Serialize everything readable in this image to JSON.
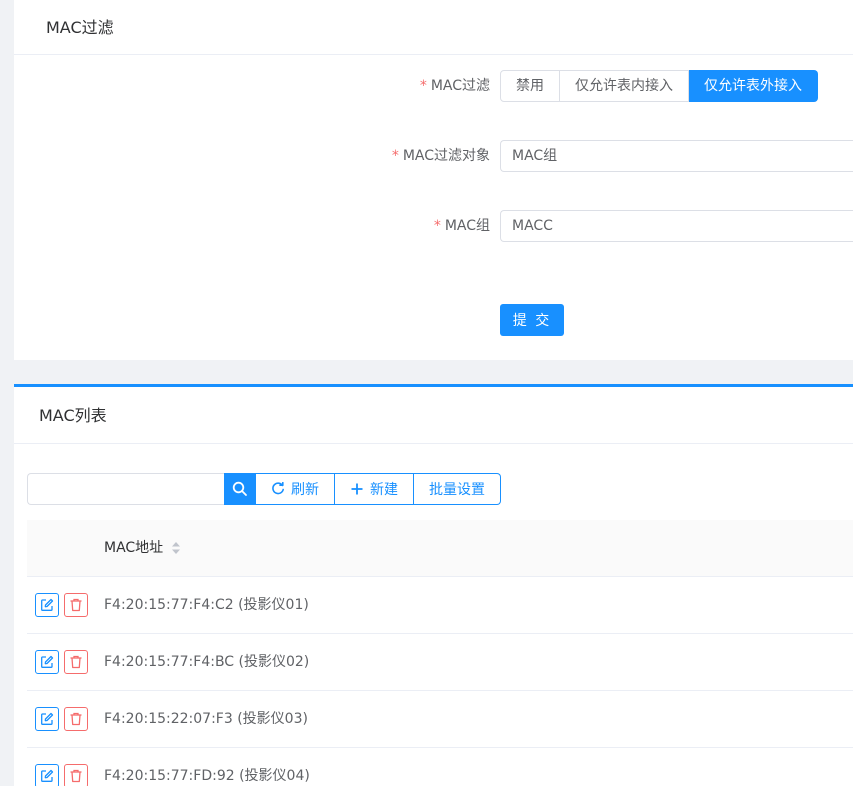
{
  "filter_card": {
    "title": "MAC过滤",
    "fields": {
      "mode": {
        "label": "MAC过滤",
        "required_mark": "*",
        "options": [
          "禁用",
          "仅允许表内接入",
          "仅允许表外接入"
        ],
        "selected_index": 2
      },
      "target": {
        "label": "MAC过滤对象",
        "required_mark": "*",
        "value": "MAC组"
      },
      "group": {
        "label": "MAC组",
        "required_mark": "*",
        "value": "MACC"
      }
    },
    "submit_label": "提 交"
  },
  "list_card": {
    "title": "MAC列表",
    "toolbar": {
      "search_placeholder": "",
      "search_icon": "search-icon",
      "refresh_label": "刷新",
      "new_label": "新建",
      "batch_label": "批量设置"
    },
    "table": {
      "header_mac": "MAC地址",
      "rows": [
        {
          "mac": "F4:20:15:77:F4:C2 (投影仪01)"
        },
        {
          "mac": "F4:20:15:77:F4:BC (投影仪02)"
        },
        {
          "mac": "F4:20:15:22:07:F3 (投影仪03)"
        },
        {
          "mac": "F4:20:15:77:FD:92 (投影仪04)"
        }
      ]
    }
  },
  "colors": {
    "primary": "#1890ff",
    "danger": "#f56c6c",
    "required": "#f56c6c"
  }
}
